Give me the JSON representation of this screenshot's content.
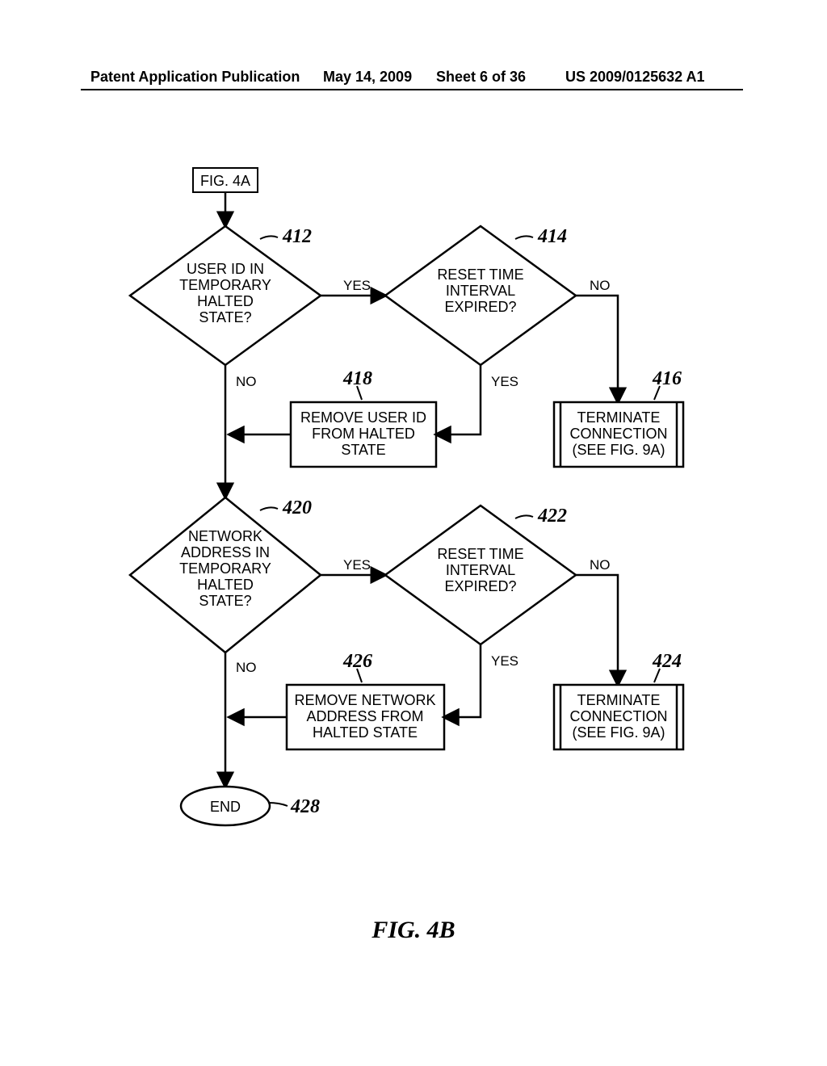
{
  "header": {
    "publication": "Patent Application Publication",
    "date": "May 14, 2009",
    "sheet": "Sheet 6 of 36",
    "number": "US 2009/0125632 A1"
  },
  "figure_title": "FIG.  4B",
  "entry_ref": "FIG. 4A",
  "decisions": {
    "d412": {
      "ref": "412",
      "l1": "USER ID IN",
      "l2": "TEMPORARY",
      "l3": "HALTED",
      "l4": "STATE?"
    },
    "d414": {
      "ref": "414",
      "l1": "RESET TIME",
      "l2": "INTERVAL",
      "l3": "EXPIRED?"
    },
    "d420": {
      "ref": "420",
      "l1": "NETWORK",
      "l2": "ADDRESS IN",
      "l3": "TEMPORARY",
      "l4": "HALTED",
      "l5": "STATE?"
    },
    "d422": {
      "ref": "422",
      "l1": "RESET TIME",
      "l2": "INTERVAL",
      "l3": "EXPIRED?"
    }
  },
  "processes": {
    "p418": {
      "ref": "418",
      "l1": "REMOVE USER ID",
      "l2": "FROM HALTED",
      "l3": "STATE"
    },
    "p416": {
      "ref": "416",
      "l1": "TERMINATE",
      "l2": "CONNECTION",
      "l3": "(SEE FIG. 9A)"
    },
    "p426": {
      "ref": "426",
      "l1": "REMOVE NETWORK",
      "l2": "ADDRESS FROM",
      "l3": "HALTED STATE"
    },
    "p424": {
      "ref": "424",
      "l1": "TERMINATE",
      "l2": "CONNECTION",
      "l3": "(SEE FIG. 9A)"
    }
  },
  "terminator": {
    "ref": "428",
    "label": "END"
  },
  "edges": {
    "yes": "YES",
    "no": "NO"
  }
}
